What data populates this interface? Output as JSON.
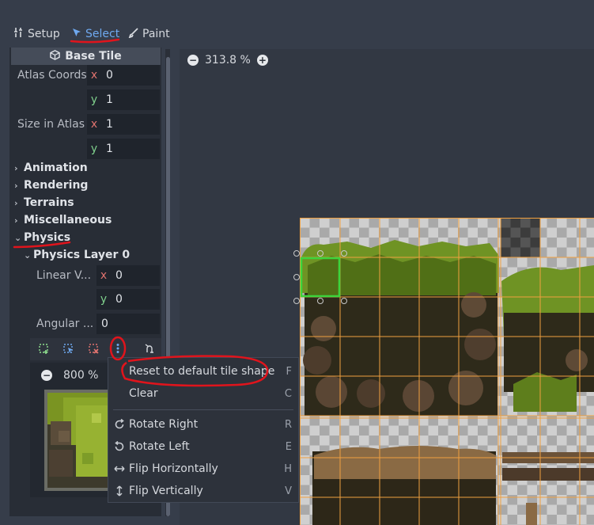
{
  "toolbar": {
    "setup_label": "Setup",
    "select_label": "Select",
    "paint_label": "Paint"
  },
  "inspector": {
    "section_title": "Base Tile",
    "atlas_coords": {
      "label": "Atlas Coords",
      "x_axis": "x",
      "x_value": "0",
      "y_axis": "y",
      "y_value": "1"
    },
    "size_in_atlas": {
      "label": "Size in Atlas",
      "x_axis": "x",
      "x_value": "1",
      "y_axis": "y",
      "y_value": "1"
    },
    "groups": [
      "Animation",
      "Rendering",
      "Terrains",
      "Miscellaneous",
      "Physics"
    ],
    "physics_layer": "Physics Layer 0",
    "linear_velocity": {
      "label": "Linear V...",
      "x_axis": "x",
      "x_value": "0",
      "y_axis": "y",
      "y_value": "0"
    },
    "angular_velocity": {
      "label": "Angular ...",
      "value": "0"
    },
    "polygon_zoom": "800 %"
  },
  "menu": {
    "items": [
      {
        "label": "Reset to default tile shape",
        "shortcut": "F",
        "icon": ""
      },
      {
        "label": "Clear",
        "shortcut": "C",
        "icon": ""
      },
      {
        "label": "Rotate Right",
        "shortcut": "R",
        "icon": "rotate-right-icon"
      },
      {
        "label": "Rotate Left",
        "shortcut": "E",
        "icon": "rotate-left-icon"
      },
      {
        "label": "Flip Horizontally",
        "shortcut": "H",
        "icon": "flip-horizontal-icon"
      },
      {
        "label": "Flip Vertically",
        "shortcut": "V",
        "icon": "flip-vertical-icon"
      }
    ]
  },
  "viewport": {
    "zoom": "313.8 %"
  },
  "colors": {
    "accent": "#6fa9f0",
    "annotation": "#e0141c",
    "selection": "#3cd43c",
    "grid": "#f0a040"
  }
}
